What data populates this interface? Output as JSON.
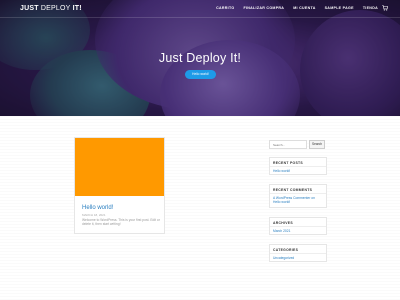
{
  "header": {
    "logo_bold": "JUST",
    "logo_thin": "DEPLOY",
    "logo_end": "IT!",
    "nav": [
      "CARRITO",
      "FINALIZAR COMPRA",
      "MI CUENTA",
      "SAMPLE PAGE",
      "TIENDA"
    ],
    "cart_icon": "cart-icon"
  },
  "hero": {
    "title": "Just Deploy It!",
    "button_label": "Hello world!"
  },
  "post": {
    "title": "Hello world!",
    "date": "MARCH 18, 2021",
    "excerpt": "Welcome to WordPress. This is your first post. Edit or delete it, then start writing!"
  },
  "sidebar": {
    "search_placeholder": "Search...",
    "search_button": "Search",
    "recent_posts_title": "RECENT POSTS",
    "recent_posts": [
      "Hello world!"
    ],
    "recent_comments_title": "RECENT COMMENTS",
    "recent_comments": [
      "A WordPress Commenter on",
      "Hello world!"
    ],
    "archives_title": "ARCHIVES",
    "archives": [
      "March 2021"
    ],
    "categories_title": "CATEGORIES",
    "categories": [
      "Uncategorized"
    ]
  },
  "colors": {
    "accent": "#1e9be8",
    "link": "#2a7fc0",
    "thumb": "#ff9900"
  }
}
